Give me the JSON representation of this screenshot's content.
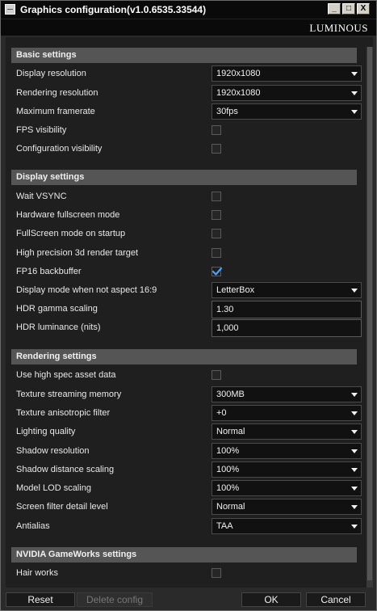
{
  "window": {
    "title": "Graphics configuration(v1.0.6535.33544)",
    "brand": "LUMINOUS",
    "controls": [
      "_",
      "□",
      "X"
    ]
  },
  "sections": {
    "basic": "Basic settings",
    "display": "Display settings",
    "rendering": "Rendering settings",
    "nvidia": "NVIDIA GameWorks settings"
  },
  "basic": {
    "display_resolution": {
      "label": "Display resolution",
      "value": "1920x1080"
    },
    "rendering_resolution": {
      "label": "Rendering resolution",
      "value": "1920x1080"
    },
    "max_framerate": {
      "label": "Maximum framerate",
      "value": "30fps"
    },
    "fps_visibility": {
      "label": "FPS visibility",
      "checked": false
    },
    "config_visibility": {
      "label": "Configuration visibility",
      "checked": false
    }
  },
  "display": {
    "wait_vsync": {
      "label": "Wait VSYNC",
      "checked": false
    },
    "hw_fullscreen": {
      "label": "Hardware fullscreen mode",
      "checked": false
    },
    "fullscreen_startup": {
      "label": "FullScreen mode on startup",
      "checked": false
    },
    "high_precision_rt": {
      "label": "High precision 3d render target",
      "checked": false
    },
    "fp16_backbuffer": {
      "label": "FP16 backbuffer",
      "checked": true
    },
    "display_mode": {
      "label": "Display mode when not aspect 16:9",
      "value": "LetterBox"
    },
    "hdr_gamma": {
      "label": "HDR gamma scaling",
      "value": "1.30"
    },
    "hdr_luminance": {
      "label": "HDR luminance (nits)",
      "value": "1,000"
    }
  },
  "rendering": {
    "high_spec_assets": {
      "label": "Use high spec asset data",
      "checked": false
    },
    "texture_streaming": {
      "label": "Texture streaming memory",
      "value": "300MB"
    },
    "texture_aniso": {
      "label": "Texture anisotropic filter",
      "value": "+0"
    },
    "lighting_quality": {
      "label": "Lighting quality",
      "value": "Normal"
    },
    "shadow_resolution": {
      "label": "Shadow resolution",
      "value": "100%"
    },
    "shadow_distance": {
      "label": "Shadow distance scaling",
      "value": "100%"
    },
    "model_lod": {
      "label": "Model LOD scaling",
      "value": "100%"
    },
    "screen_filter": {
      "label": "Screen filter detail level",
      "value": "Normal"
    },
    "antialias": {
      "label": "Antialias",
      "value": "TAA"
    }
  },
  "nvidia": {
    "hair_works": {
      "label": "Hair works",
      "checked": false
    }
  },
  "buttons": {
    "reset": "Reset",
    "delete_config": "Delete config",
    "ok": "OK",
    "cancel": "Cancel"
  }
}
